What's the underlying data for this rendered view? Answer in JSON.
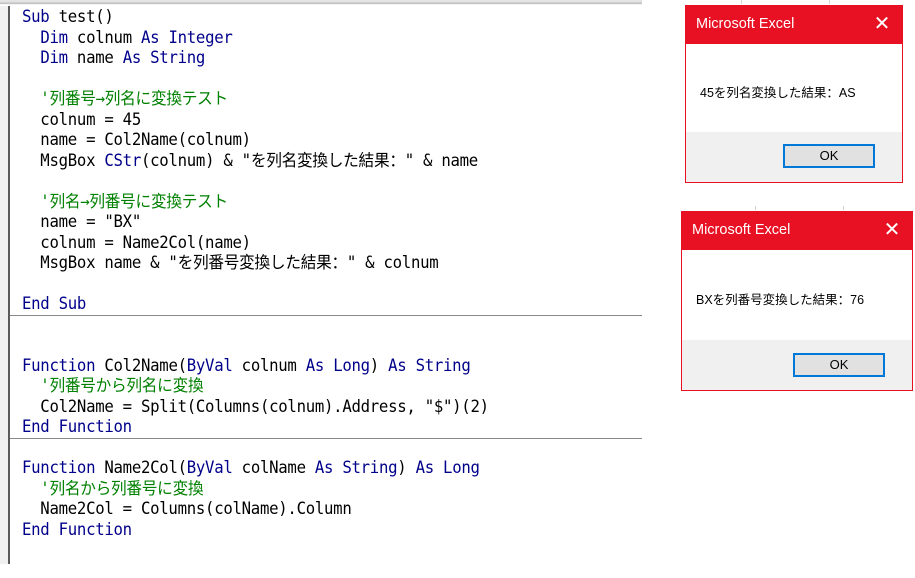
{
  "editor": {
    "procedures": [
      {
        "name": "test",
        "lines": [
          [
            {
              "t": "Sub",
              "c": "kw"
            },
            {
              "t": " test()",
              "c": ""
            }
          ],
          [
            {
              "t": "  ",
              "c": ""
            },
            {
              "t": "Dim",
              "c": "kw"
            },
            {
              "t": " colnum ",
              "c": ""
            },
            {
              "t": "As Integer",
              "c": "kw"
            }
          ],
          [
            {
              "t": "  ",
              "c": ""
            },
            {
              "t": "Dim",
              "c": "kw"
            },
            {
              "t": " name ",
              "c": ""
            },
            {
              "t": "As String",
              "c": "kw"
            }
          ],
          [],
          [
            {
              "t": "  '列番号→列名に変換テスト",
              "c": "cm"
            }
          ],
          [
            {
              "t": "  colnum = 45",
              "c": ""
            }
          ],
          [
            {
              "t": "  name = Col2Name(colnum)",
              "c": ""
            }
          ],
          [
            {
              "t": "  MsgBox ",
              "c": ""
            },
            {
              "t": "CStr",
              "c": "kw"
            },
            {
              "t": "(colnum) & \"を列名変換した結果：\" & name",
              "c": ""
            }
          ],
          [],
          [
            {
              "t": "  '列名→列番号に変換テスト",
              "c": "cm"
            }
          ],
          [
            {
              "t": "  name = \"BX\"",
              "c": ""
            }
          ],
          [
            {
              "t": "  colnum = Name2Col(name)",
              "c": ""
            }
          ],
          [
            {
              "t": "  MsgBox name & \"を列番号変換した結果：\" & colnum",
              "c": ""
            }
          ],
          [],
          [
            {
              "t": "End Sub",
              "c": "kw"
            }
          ]
        ]
      },
      {
        "name": "Col2Name",
        "lines": [
          [],
          [],
          [
            {
              "t": "Function",
              "c": "kw"
            },
            {
              "t": " Col2Name(",
              "c": ""
            },
            {
              "t": "ByVal",
              "c": "kw"
            },
            {
              "t": " colnum ",
              "c": ""
            },
            {
              "t": "As Long",
              "c": "kw"
            },
            {
              "t": ") ",
              "c": ""
            },
            {
              "t": "As String",
              "c": "kw"
            }
          ],
          [
            {
              "t": "  '列番号から列名に変換",
              "c": "cm"
            }
          ],
          [
            {
              "t": "  Col2Name = Split(Columns(colnum).Address, \"$\")(2)",
              "c": ""
            }
          ],
          [
            {
              "t": "End Function",
              "c": "kw"
            }
          ]
        ]
      },
      {
        "name": "Name2Col",
        "lines": [
          [],
          [
            {
              "t": "Function",
              "c": "kw"
            },
            {
              "t": " Name2Col(",
              "c": ""
            },
            {
              "t": "ByVal",
              "c": "kw"
            },
            {
              "t": " colName ",
              "c": ""
            },
            {
              "t": "As String",
              "c": "kw"
            },
            {
              "t": ") ",
              "c": ""
            },
            {
              "t": "As Long",
              "c": "kw"
            }
          ],
          [
            {
              "t": "  '列名から列番号に変換",
              "c": "cm"
            }
          ],
          [
            {
              "t": "  Name2Col = Columns(colName).Column",
              "c": ""
            }
          ],
          [
            {
              "t": "End Function",
              "c": "kw"
            }
          ]
        ]
      }
    ]
  },
  "dialogs": [
    {
      "title": "Microsoft Excel",
      "close_icon": "✕",
      "message": "45を列名変換した結果：AS",
      "ok_label": "OK"
    },
    {
      "title": "Microsoft Excel",
      "close_icon": "✕",
      "message": "BXを列番号変換した結果：76",
      "ok_label": "OK"
    }
  ],
  "colors": {
    "keyword": "#00008b",
    "comment": "#008000",
    "dialog_title_bar": "#e81123",
    "ok_button_border": "#0078d7"
  }
}
